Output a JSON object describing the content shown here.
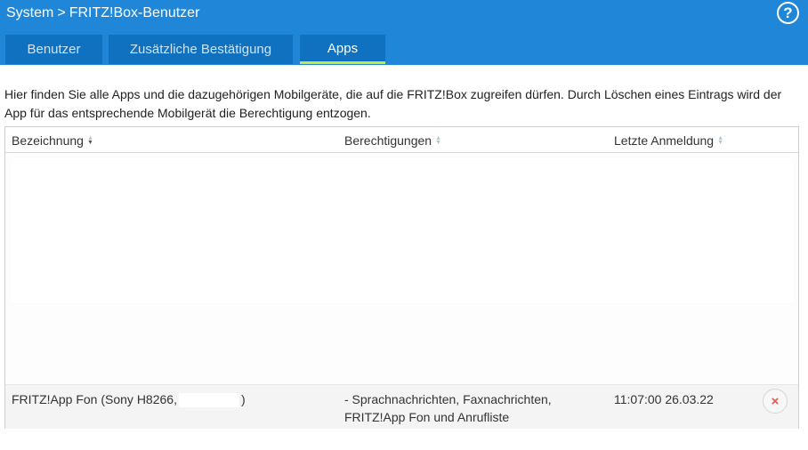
{
  "header": {
    "breadcrumb_root": "System",
    "breadcrumb_separator": ">",
    "breadcrumb_current": "FRITZ!Box-Benutzer",
    "help_label": "?"
  },
  "tabs": [
    {
      "label": "Benutzer",
      "active": false
    },
    {
      "label": "Zusätzliche Bestätigung",
      "active": false
    },
    {
      "label": "Apps",
      "active": true
    }
  ],
  "intro_text": "Hier finden Sie alle Apps und die dazugehörigen Mobilgeräte, die auf die FRITZ!Box zugreifen dürfen. Durch Löschen eines Eintrags wird der App für das entsprechende Mobilgerät die Berechtigung entzogen.",
  "table": {
    "columns": [
      "Bezeichnung",
      "Berechtigungen",
      "Letzte Anmeldung"
    ],
    "rows": [
      {
        "name_prefix": "FRITZ!App Fon (Sony H8266,",
        "name_suffix": ")",
        "permissions_line1": "- Sprachnachrichten, Faxnachrichten,",
        "permissions_line2": "FRITZ!App Fon und Anrufliste",
        "last_login": "11:07:00 26.03.22",
        "delete_label": "×"
      }
    ]
  },
  "colors": {
    "topbar": "#1f86d8",
    "tab": "#1071c0",
    "active_tab_underline": "#c8e642",
    "delete_icon": "#e0544d"
  }
}
